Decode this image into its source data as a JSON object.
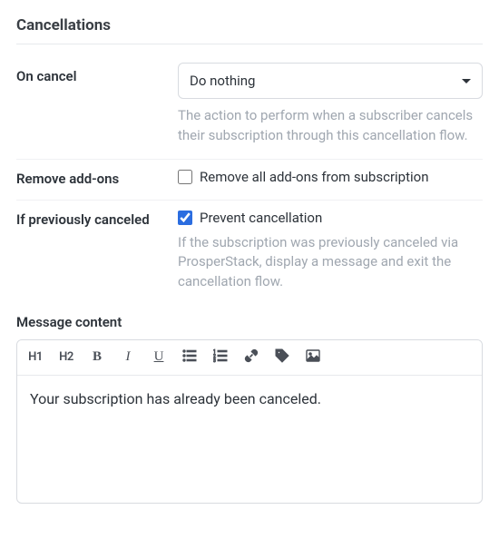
{
  "section_title": "Cancellations",
  "on_cancel": {
    "label": "On cancel",
    "value": "Do nothing",
    "help": "The action to perform when a subscriber cancels their subscription through this cancellation flow."
  },
  "remove_addons": {
    "label": "Remove add-ons",
    "checkbox_label": "Remove all add-ons from subscription",
    "checked": false
  },
  "if_previously_canceled": {
    "label": "If previously canceled",
    "checkbox_label": "Prevent cancellation",
    "checked": true,
    "help": "If the subscription was previously canceled via ProsperStack, display a message and exit the cancellation flow."
  },
  "message_content": {
    "label": "Message content",
    "body": "Your subscription has already been canceled."
  },
  "toolbar": {
    "h1": "H1",
    "h2": "H2",
    "bold": "B",
    "italic": "I",
    "underline": "U"
  }
}
